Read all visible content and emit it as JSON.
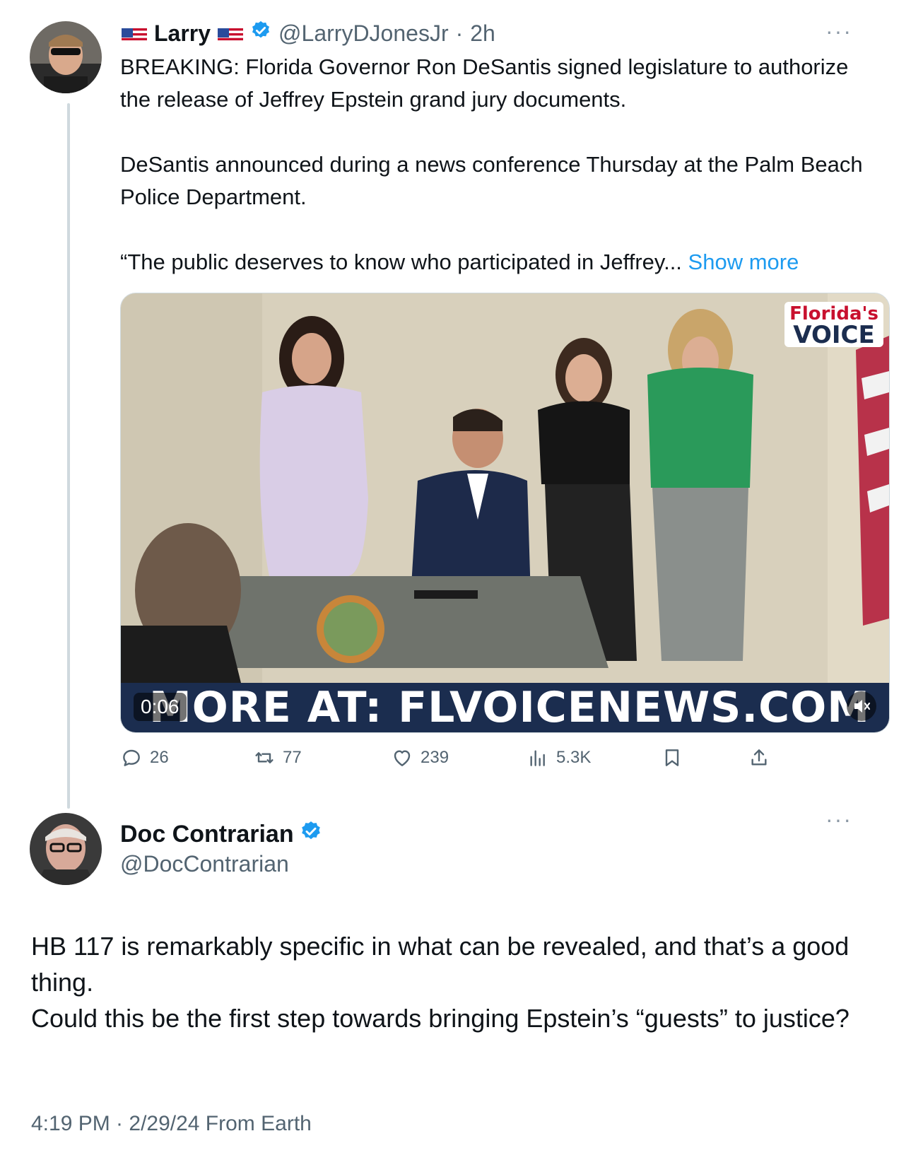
{
  "tweet": {
    "author": {
      "name": "Larry",
      "handle": "@LarryDJonesJr",
      "time": "2h",
      "separator": "·",
      "verified": true,
      "avatar": "avatar-man-sunglasses"
    },
    "more_label": "···",
    "paragraphs": [
      "BREAKING: Florida Governor Ron DeSantis signed legislature to authorize the release of Jeffrey Epstein grand jury documents.",
      "DeSantis announced during a news conference Thursday at the Palm Beach Police Department.",
      "“The public deserves to know who participated in Jeffrey..."
    ],
    "show_more": "Show more",
    "media": {
      "type": "video",
      "duration": "0:06",
      "banner_text": "MORE AT: FLVOICENEWS.COM",
      "logo_line1": "Florida's",
      "logo_line2": "VOICE",
      "muted": true
    },
    "actions": {
      "replies": "26",
      "reposts": "77",
      "likes": "239",
      "views": "5.3K"
    }
  },
  "reply": {
    "author": {
      "name": "Doc Contrarian",
      "handle": "@DocContrarian",
      "verified": true,
      "avatar": "avatar-old-man-glasses"
    },
    "more_label": "···",
    "paragraphs": [
      "HB 117 is remarkably specific in what can be revealed, and that’s a good thing.",
      "Could this be the first step towards bringing Epstein’s “guests” to justice?"
    ],
    "timestamp": "4:19 PM · 2/29/24 From Earth"
  },
  "colors": {
    "accent": "#1d9bf0",
    "secondary_text": "#536471",
    "text": "#0f1419",
    "thread_line": "#cfd9de",
    "banner": "#1b2d4f"
  }
}
